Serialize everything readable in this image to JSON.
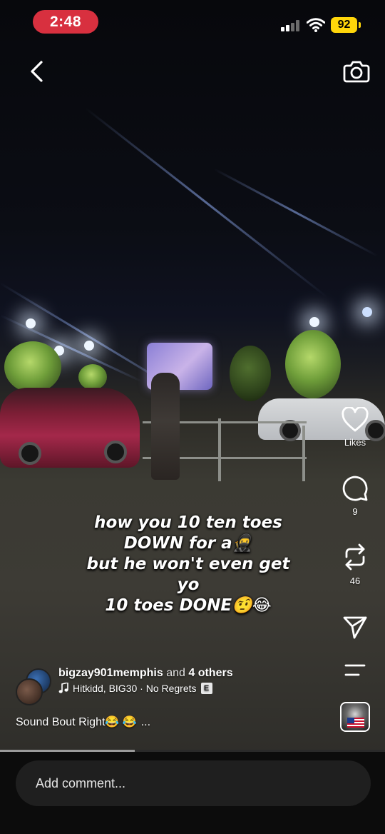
{
  "status_bar": {
    "time": "2:48",
    "battery": "92"
  },
  "icons": {
    "back": "chevron-left-icon",
    "camera": "camera-icon",
    "like": "heart-icon",
    "comment": "comment-icon",
    "repost": "repost-icon",
    "share": "send-icon",
    "more": "menu-icon",
    "music": "music-note-icon"
  },
  "colors": {
    "time_pill": "#d8303f",
    "battery": "#ffd60a"
  },
  "video": {
    "caption_lines": [
      "how you 10 ten toes",
      "DOWN for a🥷",
      "but he won't even get",
      "yo",
      "10 toes DONE🤨😂"
    ],
    "progress": 0.35
  },
  "actions": {
    "likes_label": "Likes",
    "comments_count": "9",
    "reposts_count": "46"
  },
  "post": {
    "author": "bigzay901memphis",
    "collab_connector": "and",
    "collab_others": "4 others",
    "audio": "Hitkidd, BIG30 · No Regrets",
    "explicit_badge": "E",
    "description": "Sound Bout Right😂 😂",
    "more": "..."
  },
  "comment_bar": {
    "placeholder": "Add comment..."
  }
}
